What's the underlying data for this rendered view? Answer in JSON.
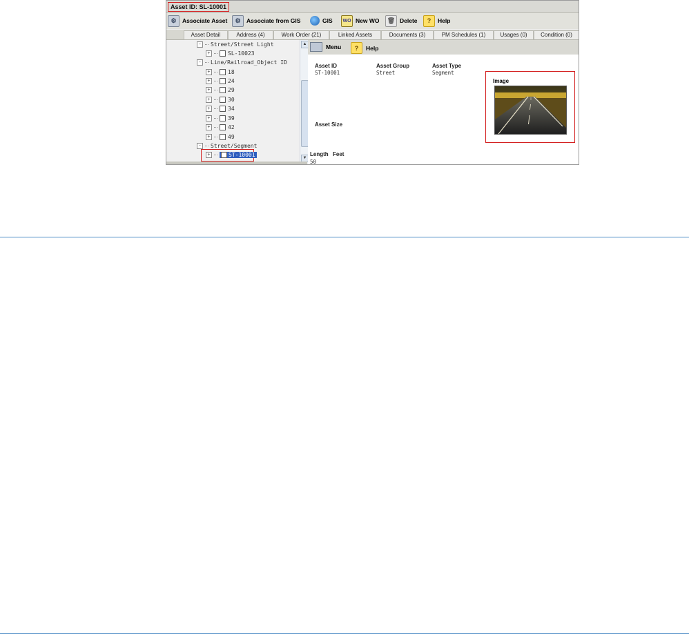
{
  "window": {
    "asset_id_title": "Asset ID: SL-10001"
  },
  "toolbar": {
    "associate_asset": "Associate Asset",
    "associate_from_gis": "Associate from GIS",
    "gis": "GIS",
    "new_wo": "New WO",
    "new_wo_icon_text": "WO",
    "delete": "Delete",
    "help": "Help"
  },
  "tabs": [
    "Asset Detail",
    "Address (4)",
    "Work Order (21)",
    "Linked Assets",
    "Documents (3)",
    "PM Schedules (1)",
    "Usages (0)",
    "Condition (0)"
  ],
  "tree": {
    "group1": "Street/Street Light",
    "group1_items": [
      "SL-10023"
    ],
    "group2": "Line/Railroad_Object ID",
    "group2_items": [
      "18",
      "24",
      "29",
      "30",
      "34",
      "39",
      "42",
      "49"
    ],
    "group3": "Street/Segment",
    "selected_item": "ST-10001"
  },
  "detail": {
    "menu_label": "Menu",
    "help_label": "Help",
    "asset_id_label": "Asset ID",
    "asset_id_value": "ST-10001",
    "asset_group_label": "Asset Group",
    "asset_group_value": "Street",
    "asset_type_label": "Asset Type",
    "asset_type_value": "Segment",
    "asset_size_label": "Asset Size",
    "length_label": "Length",
    "feet_label": "Feet",
    "length_value": "50",
    "image_label": "Image"
  },
  "icons": {
    "plus": "+",
    "minus": "-",
    "help": "?",
    "scroll_up": "▲",
    "scroll_down": "▼"
  },
  "colors": {
    "highlight": "#d42020",
    "selection": "#2f5fbf",
    "rule": "#4a8ac4"
  }
}
